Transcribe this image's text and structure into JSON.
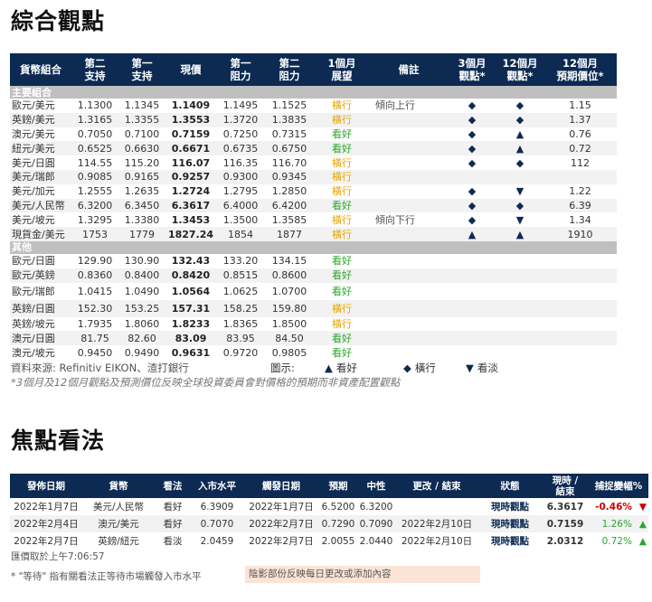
{
  "section1": {
    "title": "綜合觀點",
    "headers": [
      "貨幣組合",
      "第二\n支持",
      "第一\n支持",
      "現價",
      "第一\n阻力",
      "第二\n阻力",
      "1個月\n展望",
      "備註",
      "3個月\n觀點*",
      "12個月\n觀點*",
      "12個月\n預期價位*"
    ],
    "groups": [
      {
        "name": "主要組合",
        "rows": [
          {
            "pair": "歐元/美元",
            "s2": "1.1300",
            "s1": "1.1345",
            "price": "1.1409",
            "r1": "1.1495",
            "r2": "1.1525",
            "outlook": "橫行",
            "tone": "side",
            "note": "傾向上行",
            "m3": "◆",
            "m12": "◆",
            "target": "1.15"
          },
          {
            "pair": "英鎊/美元",
            "s2": "1.3165",
            "s1": "1.3355",
            "price": "1.3553",
            "r1": "1.3720",
            "r2": "1.3835",
            "outlook": "橫行",
            "tone": "side",
            "note": "",
            "m3": "◆",
            "m12": "◆",
            "target": "1.37"
          },
          {
            "pair": "澳元/美元",
            "s2": "0.7050",
            "s1": "0.7100",
            "price": "0.7159",
            "r1": "0.7250",
            "r2": "0.7315",
            "outlook": "看好",
            "tone": "up",
            "note": "",
            "m3": "◆",
            "m12": "▲",
            "target": "0.76"
          },
          {
            "pair": "紐元/美元",
            "s2": "0.6525",
            "s1": "0.6630",
            "price": "0.6671",
            "r1": "0.6735",
            "r2": "0.6750",
            "outlook": "看好",
            "tone": "up",
            "note": "",
            "m3": "◆",
            "m12": "▲",
            "target": "0.72"
          },
          {
            "pair": "美元/日圓",
            "s2": "114.55",
            "s1": "115.20",
            "price": "116.07",
            "r1": "116.35",
            "r2": "116.70",
            "outlook": "橫行",
            "tone": "side",
            "note": "",
            "m3": "◆",
            "m12": "◆",
            "target": "112"
          },
          {
            "pair": "美元/瑞郎",
            "s2": "0.9085",
            "s1": "0.9165",
            "price": "0.9257",
            "r1": "0.9300",
            "r2": "0.9345",
            "outlook": "橫行",
            "tone": "side",
            "note": "",
            "m3": "",
            "m12": "",
            "target": ""
          },
          {
            "pair": "美元/加元",
            "s2": "1.2555",
            "s1": "1.2635",
            "price": "1.2724",
            "r1": "1.2795",
            "r2": "1.2850",
            "outlook": "橫行",
            "tone": "side",
            "note": "",
            "m3": "◆",
            "m12": "▼",
            "target": "1.22"
          },
          {
            "pair": "美元/人民幣",
            "s2": "6.3200",
            "s1": "6.3450",
            "price": "6.3617",
            "r1": "6.4000",
            "r2": "6.4200",
            "outlook": "看好",
            "tone": "up",
            "note": "",
            "m3": "◆",
            "m12": "◆",
            "target": "6.39"
          },
          {
            "pair": "美元/坡元",
            "s2": "1.3295",
            "s1": "1.3380",
            "price": "1.3453",
            "r1": "1.3500",
            "r2": "1.3585",
            "outlook": "橫行",
            "tone": "side",
            "note": "傾向下行",
            "m3": "◆",
            "m12": "▼",
            "target": "1.34"
          },
          {
            "pair": "現貨金/美元",
            "s2": "1753",
            "s1": "1779",
            "price": "1827.24",
            "r1": "1854",
            "r2": "1877",
            "outlook": "橫行",
            "tone": "side",
            "note": "",
            "m3": "▲",
            "m12": "▲",
            "target": "1910"
          }
        ]
      },
      {
        "name": "其他",
        "rows": [
          {
            "pair": "歐元/日圓",
            "s2": "129.90",
            "s1": "130.90",
            "price": "132.43",
            "r1": "133.20",
            "r2": "134.15",
            "outlook": "看好",
            "tone": "up",
            "note": "",
            "m3": "",
            "m12": "",
            "target": ""
          },
          {
            "pair": "歐元/英鎊",
            "s2": "0.8360",
            "s1": "0.8400",
            "price": "0.8420",
            "r1": "0.8515",
            "r2": "0.8600",
            "outlook": "看好",
            "tone": "up",
            "note": "",
            "m3": "",
            "m12": "",
            "target": ""
          },
          {
            "pair": "歐元/瑞郎",
            "s2": "1.0415",
            "s1": "1.0490",
            "price": "1.0564",
            "r1": "1.0625",
            "r2": "1.0700",
            "outlook": "看好",
            "tone": "up",
            "note": "",
            "m3": "",
            "m12": "",
            "target": ""
          },
          {
            "pair": "英鎊/日圓",
            "s2": "152.30",
            "s1": "153.25",
            "price": "157.31",
            "r1": "158.25",
            "r2": "159.80",
            "outlook": "橫行",
            "tone": "side",
            "note": "",
            "m3": "",
            "m12": "",
            "target": ""
          },
          {
            "pair": "英鎊/坡元",
            "s2": "1.7935",
            "s1": "1.8060",
            "price": "1.8233",
            "r1": "1.8365",
            "r2": "1.8500",
            "outlook": "橫行",
            "tone": "side",
            "note": "",
            "m3": "",
            "m12": "",
            "target": ""
          },
          {
            "pair": "澳元/日圓",
            "s2": "81.75",
            "s1": "82.60",
            "price": "83.09",
            "r1": "83.95",
            "r2": "84.50",
            "outlook": "看好",
            "tone": "up",
            "note": "",
            "m3": "",
            "m12": "",
            "target": ""
          },
          {
            "pair": "澳元/坡元",
            "s2": "0.9450",
            "s1": "0.9490",
            "price": "0.9631",
            "r1": "0.9720",
            "r2": "0.9805",
            "outlook": "看好",
            "tone": "up",
            "note": "",
            "m3": "",
            "m12": "",
            "target": ""
          }
        ]
      }
    ],
    "source": "資料來源: Refinitiv EIKON、渣打銀行",
    "legend_title": "圖示:",
    "legend": [
      {
        "symbol": "▲",
        "label": "看好"
      },
      {
        "symbol": "◆",
        "label": "橫行"
      },
      {
        "symbol": "▼",
        "label": "看淡"
      }
    ],
    "disclaimer": "*3個月及12個月觀點及預測價位反映全球投資委員會對價格的預期而非資產配置觀點"
  },
  "section2": {
    "title": "焦點看法",
    "headers": [
      "發佈日期",
      "貨幣",
      "看法",
      "入市水平",
      "觸發日期",
      "預期",
      "中性",
      "更改 / 結束",
      "狀態",
      "現時 /\n結束",
      "捕捉變幅%"
    ],
    "rows": [
      {
        "date": "2022年1月7日",
        "pair": "美元/人民幣",
        "view": "看好",
        "viewTone": "up",
        "entry": "6.3909",
        "trigger": "2022年1月7日",
        "expect": "6.5200",
        "neutral": "6.3200",
        "change": "",
        "status": "現時觀點",
        "current": "6.3617",
        "pct": "-0.46%",
        "pctTone": "neg",
        "arrow": "▼"
      },
      {
        "date": "2022年2月4日",
        "pair": "澳元/美元",
        "view": "看好",
        "viewTone": "up",
        "entry": "0.7070",
        "trigger": "2022年2月7日",
        "expect": "0.7290",
        "neutral": "0.7090",
        "change": "2022年2月10日",
        "status": "現時觀點",
        "current": "0.7159",
        "pct": "1.26%",
        "pctTone": "pos",
        "arrow": "▲"
      },
      {
        "date": "2022年2月7日",
        "pair": "英鎊/紐元",
        "view": "看淡",
        "viewTone": "down",
        "entry": "2.0459",
        "trigger": "2022年2月7日",
        "expect": "2.0055",
        "neutral": "2.0440",
        "change": "2022年2月10日",
        "status": "現時觀點",
        "current": "2.0312",
        "pct": "0.72%",
        "pctTone": "pos",
        "arrow": "▲"
      }
    ],
    "price_time": "匯價取於上午7:06:57",
    "wait_note": "* \"等待\" 指有關看法正等待市場觸發入市水平",
    "hidden_note": "陰影部份反映每日更改或添加內容"
  },
  "colors": {
    "header_bg": "#0c2a52",
    "section_bg": "#bfbfbf",
    "sideways": "#e8a400",
    "bullish": "#2aa52a",
    "bearish": "#cc0000",
    "highlight": "#fbe4d5"
  }
}
